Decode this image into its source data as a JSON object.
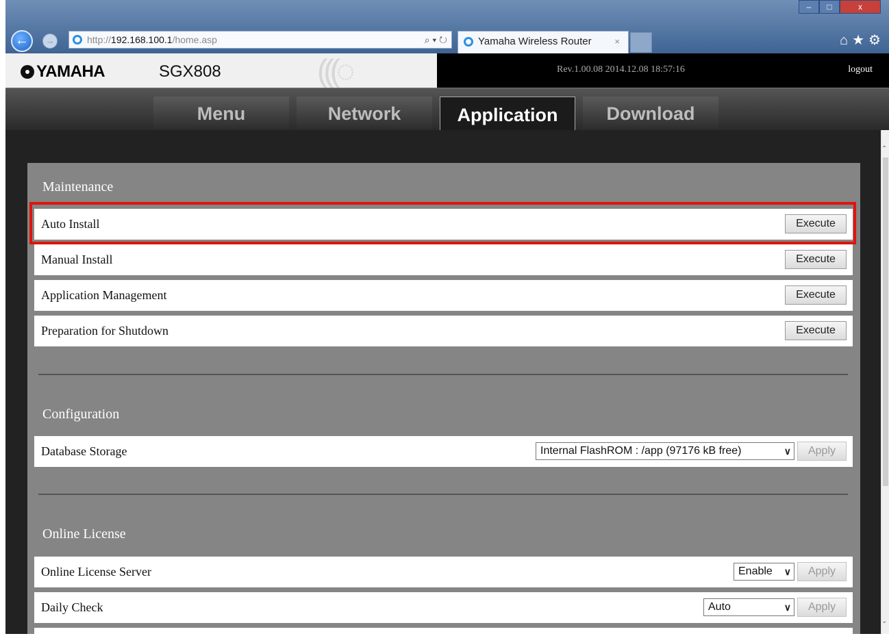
{
  "browser": {
    "address_prefix": "http://",
    "address_host": "192.168.100.1",
    "address_path": "/home.asp",
    "address_controls": "⌕ ▾ ↻",
    "tab_title": "Yamaha Wireless Router",
    "tab_close": "×",
    "back_glyph": "←",
    "fwd_glyph": "→",
    "toolbar_glyphs": "⌂★⚙",
    "win_min": "–",
    "win_max": "□",
    "win_close": "x"
  },
  "header": {
    "brand": "YAMAHA",
    "model": "SGX808",
    "waves": "(((◌",
    "revision": "Rev.1.00.08  2014.12.08 18:57:16",
    "logout": "logout"
  },
  "tabs": [
    {
      "label": "Menu",
      "active": false
    },
    {
      "label": "Network",
      "active": false
    },
    {
      "label": "Application",
      "active": true
    },
    {
      "label": "Download",
      "active": false
    }
  ],
  "maintenance": {
    "title": "Maintenance",
    "rows": [
      {
        "label": "Auto Install",
        "button": "Execute"
      },
      {
        "label": "Manual Install",
        "button": "Execute"
      },
      {
        "label": "Application Management",
        "button": "Execute"
      },
      {
        "label": "Preparation for Shutdown",
        "button": "Execute"
      }
    ]
  },
  "configuration": {
    "title": "Configuration",
    "database_storage": {
      "label": "Database Storage",
      "value": "Internal FlashROM : /app (97176 kB free)",
      "button": "Apply"
    }
  },
  "online_license": {
    "title": "Online License",
    "server": {
      "label": "Online License Server",
      "value": "Enable",
      "button": "Apply"
    },
    "daily_check": {
      "label": "Daily Check",
      "value": "Auto",
      "button": "Apply"
    }
  },
  "colors": {
    "highlight": "#e0140c",
    "panel": "#858585",
    "page_bg": "#222222"
  }
}
